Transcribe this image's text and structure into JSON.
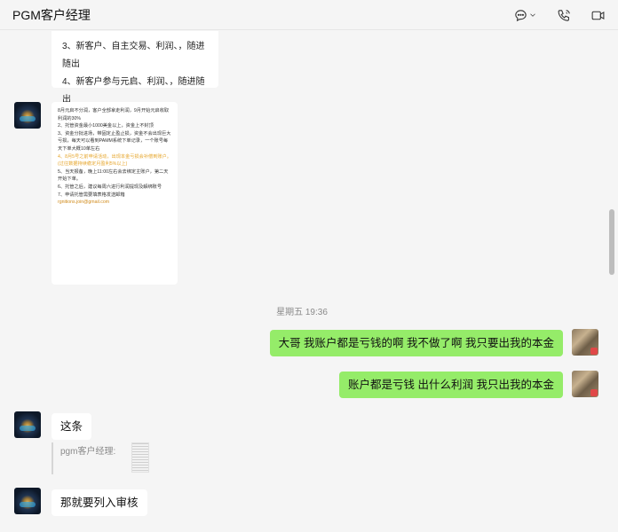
{
  "header": {
    "title": "PGM客户经理",
    "icons": [
      "chat-bubble-icon",
      "chevron-down-icon",
      "phone-icon",
      "video-camera-icon"
    ]
  },
  "messages": {
    "card1_lines": [
      "3、新客户、自主交易、利润、，随进随出",
      "4、新客户参与元启、利润、，随进随出"
    ],
    "card2_lines": [
      "8月元启不分润，客户全部拿走利润，9月开始元启收取利润的30%",
      "2、托管资金最小1000美金以上，资金上不封顶",
      "3、资金分批进场，带固定止盈止损，资金不会出现巨大亏损，每天可以看到PAMM系统下单记录，一个账号每天下单大概10单左右",
      "4、8月5号之前申请活动，出现本金亏损会补偿到账户。(过往数据持续稳定月盈利5%以上)",
      "5、当天报备，晚上11:00左右会去绑定主账户，第二天开始下单。",
      "6、托管之后，建议每周六进行利润提现及解绑账号",
      "7、申请托管需要填表格发送邮箱",
      "rgnitions.join@gmail.com"
    ],
    "timestamp": "星期五 19:36",
    "out1": "大哥 我账户都是亏钱的啊 我不做了啊 我只要出我的本金",
    "out2": "账户都是亏钱 出什么利润 我只出我的本金",
    "in1": "这条",
    "quote_label": "pgm客户经理:",
    "in2": "那就要列入审核"
  },
  "colors": {
    "outgoing_bubble": "#95ec69",
    "incoming_bubble": "#ffffff",
    "background": "#f5f5f5"
  }
}
